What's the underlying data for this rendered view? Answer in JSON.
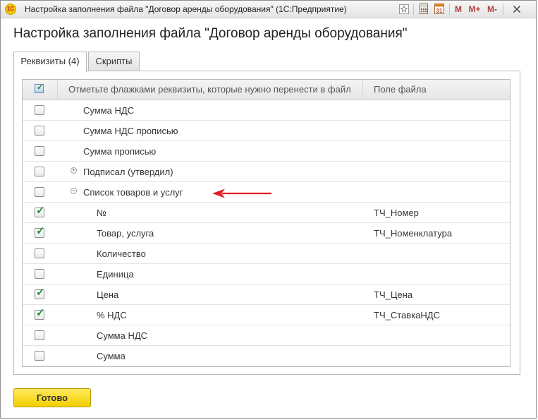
{
  "window": {
    "title": "Настройка заполнения файла \"Договор аренды оборудования\"  (1С:Предприятие)",
    "app_icon_label": "1С",
    "toolbar": {
      "m_label": "M",
      "m_plus_label": "M+",
      "m_minus_label": "M-",
      "calendar_day": "31"
    }
  },
  "heading": "Настройка заполнения файла \"Договор аренды оборудования\"",
  "tabs": [
    {
      "label": "Реквизиты (4)",
      "active": true
    },
    {
      "label": "Скрипты",
      "active": false
    }
  ],
  "table": {
    "columns": {
      "name": "Отметьте флажками реквизиты, которые нужно перенести в файл",
      "field": "Поле файла"
    },
    "rows": [
      {
        "checked": false,
        "name": "Сумма НДС",
        "field": ""
      },
      {
        "checked": false,
        "name": "Сумма НДС прописью",
        "field": ""
      },
      {
        "checked": false,
        "name": "Сумма прописью",
        "field": ""
      },
      {
        "checked": false,
        "name": "Подписал (утвердил)",
        "field": ""
      },
      {
        "checked": false,
        "name": "Список товаров и услуг",
        "field": ""
      },
      {
        "checked": true,
        "name": "№",
        "field": "ТЧ_Номер"
      },
      {
        "checked": true,
        "name": "Товар, услуга",
        "field": "ТЧ_Номенклатура"
      },
      {
        "checked": false,
        "name": "Количество",
        "field": ""
      },
      {
        "checked": false,
        "name": "Единица",
        "field": ""
      },
      {
        "checked": true,
        "name": "Цена",
        "field": "ТЧ_Цена"
      },
      {
        "checked": true,
        "name": "% НДС",
        "field": "ТЧ_СтавкаНДС"
      },
      {
        "checked": false,
        "name": "Сумма НДС",
        "field": ""
      },
      {
        "checked": false,
        "name": "Сумма",
        "field": ""
      }
    ]
  },
  "colors": {
    "check_mark": "#1f8f3a",
    "annotation_arrow": "#e02020",
    "primary_button": "#f3cf00"
  },
  "buttons": {
    "done": "Готово"
  }
}
